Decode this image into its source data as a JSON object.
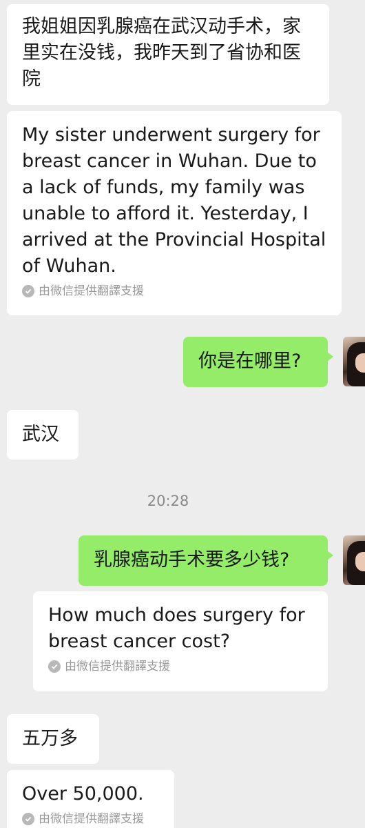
{
  "messages": [
    {
      "text": "我姐姐因乳腺癌在武汉动手术，家里实在没钱，我昨天到了省协和医院"
    },
    {
      "text": "My sister underwent surgery for breast cancer in Wuhan. Due to a lack of funds, my family was unable to afford it. Yesterday, I arrived at the Provincial Hospital of Wuhan.",
      "note": "由微信提供翻譯支援"
    },
    {
      "text": "你是在哪里?"
    },
    {
      "text": "武汉"
    },
    {
      "text": "乳腺癌动手术要多少钱?"
    },
    {
      "text": "How much does surgery for breast cancer cost?",
      "note": "由微信提供翻譯支援"
    },
    {
      "text": "五万多"
    },
    {
      "text": "Over 50,000.",
      "note": "由微信提供翻譯支援"
    }
  ],
  "timestamp": "20:28",
  "colors": {
    "background": "#ededed",
    "incoming": "#ffffff",
    "outgoing": "#95ec69",
    "note": "#9a9a9a"
  }
}
